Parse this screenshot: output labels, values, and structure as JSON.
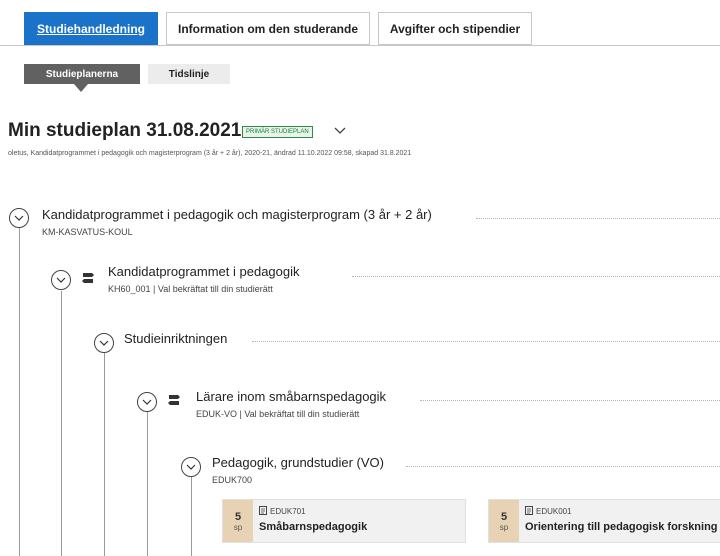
{
  "tabs": [
    {
      "label": "Studiehandledning"
    },
    {
      "label": "Information om den studerande"
    },
    {
      "label": "Avgifter och stipendier"
    }
  ],
  "subtabs": [
    {
      "label": "Studieplanerna"
    },
    {
      "label": "Tidslinje"
    }
  ],
  "plan": {
    "title": "Min studieplan 31.08.2021",
    "badge": "PRIMÄR STUDIEPLAN",
    "meta": "oletus, Kandidatprogrammet i pedagogik och magisterprogram (3 år + 2 år), 2020-21, ändrad 11.10.2022 09:58, skapad 31.8.2021"
  },
  "tree": [
    {
      "title": "Kandidatprogrammet i pedagogik och magisterprogram (3 år + 2 år)",
      "code": "KM-KASVATUS-KOUL"
    },
    {
      "title": "Kandidatprogrammet i pedagogik",
      "code": "KH60_001 | Val bekräftat till din studierätt"
    },
    {
      "title": "Studieinriktningen",
      "code": ""
    },
    {
      "title": "Lärare inom småbarnspedagogik",
      "code": "EDUK-VO | Val bekräftat till din studierätt"
    },
    {
      "title": "Pedagogik, grundstudier (VO)",
      "code": "EDUK700"
    }
  ],
  "courses": [
    {
      "credits": "5",
      "unit": "sp",
      "code": "EDUK701",
      "name": "Småbarnspedagogik"
    },
    {
      "credits": "5",
      "unit": "sp",
      "code": "EDUK001",
      "name": "Orientering till pedagogisk forskning"
    }
  ]
}
